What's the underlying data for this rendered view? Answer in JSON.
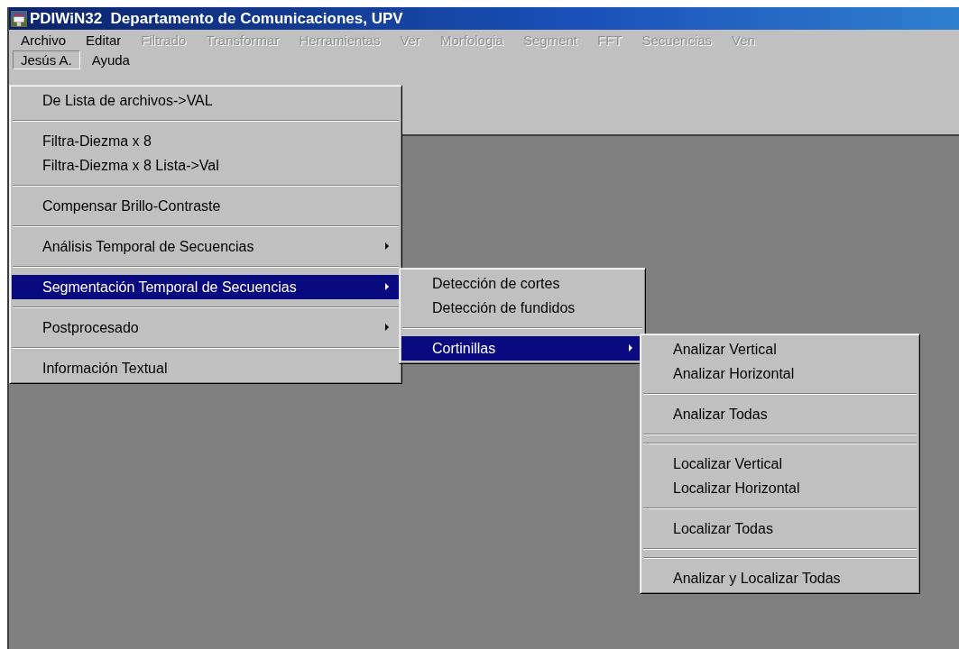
{
  "window": {
    "title": "PDIWiN32  Departamento de Comunicaciones, UPV"
  },
  "menu_bar": {
    "rows": [
      {
        "items": [
          {
            "label": "Archivo",
            "disabled": false,
            "selected": false
          },
          {
            "label": "Editar",
            "disabled": false,
            "selected": false
          },
          {
            "label": "Filtrado",
            "disabled": true,
            "selected": false
          },
          {
            "label": "Transformar",
            "disabled": true,
            "selected": false
          },
          {
            "label": "Herramientas",
            "disabled": true,
            "selected": false
          },
          {
            "label": "Ver",
            "disabled": true,
            "selected": false
          },
          {
            "label": "Morfologia",
            "disabled": true,
            "selected": false
          },
          {
            "label": "Segment",
            "disabled": true,
            "selected": false
          },
          {
            "label": "FFT",
            "disabled": true,
            "selected": false
          },
          {
            "label": "Secuencias",
            "disabled": true,
            "selected": false
          },
          {
            "label": "Ven",
            "disabled": true,
            "selected": false
          }
        ]
      },
      {
        "items": [
          {
            "label": "Jesús A.",
            "disabled": false,
            "selected": true
          },
          {
            "label": "Ayuda",
            "disabled": false,
            "selected": false
          }
        ]
      }
    ]
  },
  "menus": [
    {
      "entries": [
        {
          "kind": "item",
          "label": "De Lista de archivos->VAL",
          "submenu": false,
          "selected": false
        },
        {
          "kind": "separator"
        },
        {
          "kind": "item",
          "label": "Filtra-Diezma x 8",
          "submenu": false,
          "selected": false
        },
        {
          "kind": "item",
          "label": "Filtra-Diezma x 8 Lista->Val",
          "submenu": false,
          "selected": false
        },
        {
          "kind": "separator"
        },
        {
          "kind": "item",
          "label": "Compensar Brillo-Contraste",
          "submenu": false,
          "selected": false
        },
        {
          "kind": "separator"
        },
        {
          "kind": "item",
          "label": "Análisis Temporal de Secuencias",
          "submenu": true,
          "selected": false
        },
        {
          "kind": "separator"
        },
        {
          "kind": "item",
          "label": "Segmentación Temporal de Secuencias",
          "submenu": true,
          "selected": true
        },
        {
          "kind": "separator"
        },
        {
          "kind": "item",
          "label": "Postprocesado",
          "submenu": true,
          "selected": false
        },
        {
          "kind": "separator"
        },
        {
          "kind": "item",
          "label": "Información Textual",
          "submenu": false,
          "selected": false
        }
      ]
    },
    {
      "entries": [
        {
          "kind": "item",
          "label": "Detección de cortes",
          "submenu": false,
          "selected": false
        },
        {
          "kind": "item",
          "label": "Detección de fundidos",
          "submenu": false,
          "selected": false
        },
        {
          "kind": "separator"
        },
        {
          "kind": "item",
          "label": "Cortinillas",
          "submenu": true,
          "selected": true
        }
      ]
    },
    {
      "entries": [
        {
          "kind": "item",
          "label": "Analizar Vertical",
          "submenu": false,
          "selected": false
        },
        {
          "kind": "item",
          "label": "Analizar Horizontal",
          "submenu": false,
          "selected": false
        },
        {
          "kind": "separator"
        },
        {
          "kind": "item",
          "label": "Analizar Todas",
          "submenu": false,
          "selected": false
        },
        {
          "kind": "separator"
        },
        {
          "kind": "separator"
        },
        {
          "kind": "item",
          "label": "Localizar Vertical",
          "submenu": false,
          "selected": false
        },
        {
          "kind": "item",
          "label": "Localizar Horizontal",
          "submenu": false,
          "selected": false
        },
        {
          "kind": "separator"
        },
        {
          "kind": "item",
          "label": "Localizar Todas",
          "submenu": false,
          "selected": false
        },
        {
          "kind": "separator"
        },
        {
          "kind": "separator"
        },
        {
          "kind": "item",
          "label": "Analizar y Localizar Todas",
          "submenu": false,
          "selected": false
        }
      ]
    }
  ]
}
